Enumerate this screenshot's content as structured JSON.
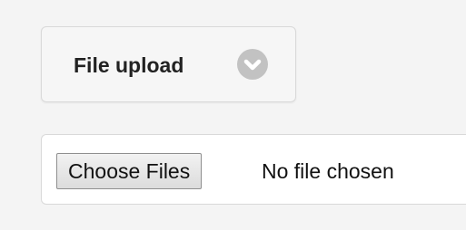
{
  "file_upload": {
    "title": "File upload",
    "toggle_icon": "chevron-down-icon"
  },
  "file_input": {
    "button_label": "Choose Files",
    "status_text": "No file chosen"
  },
  "colors": {
    "background": "#f4f4f4",
    "badge": "#c2c2c2",
    "panel_border": "#d9d9d9"
  }
}
